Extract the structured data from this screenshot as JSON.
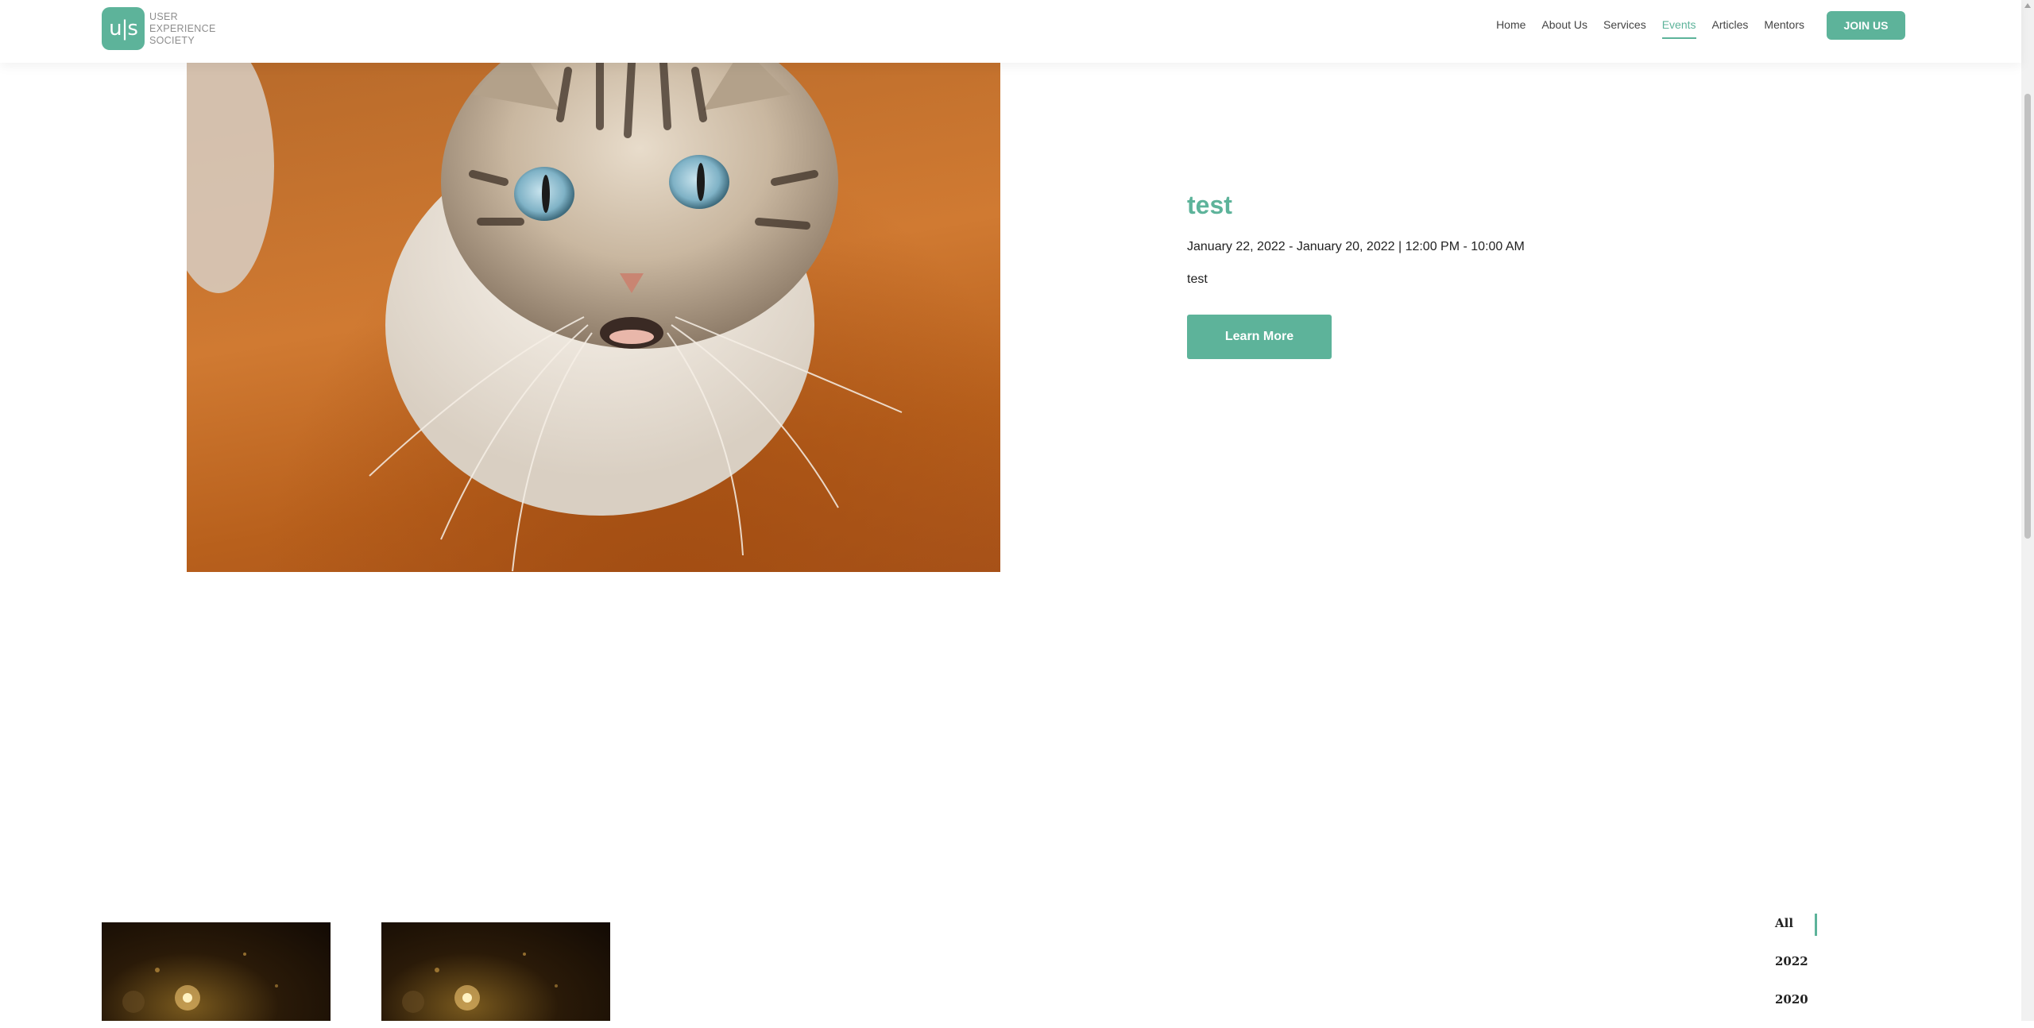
{
  "header": {
    "logo_mark": "u|s",
    "logo_lines": [
      "USER",
      "EXPERIENCE",
      "SOCIETY"
    ],
    "nav": [
      "Home",
      "About Us",
      "Services",
      "Events",
      "Articles",
      "Mentors"
    ],
    "active_nav": "Events",
    "join_label": "JOIN US"
  },
  "event": {
    "title": "test",
    "dates": "January 22, 2022 - January 20, 2022 | 12:00 PM - 10:00 AM",
    "description": "test",
    "cta_label": "Learn More"
  },
  "filters": [
    "All",
    "2022",
    "2020"
  ],
  "active_filter": "All",
  "colors": {
    "accent": "#5db39a",
    "text": "#222222"
  }
}
